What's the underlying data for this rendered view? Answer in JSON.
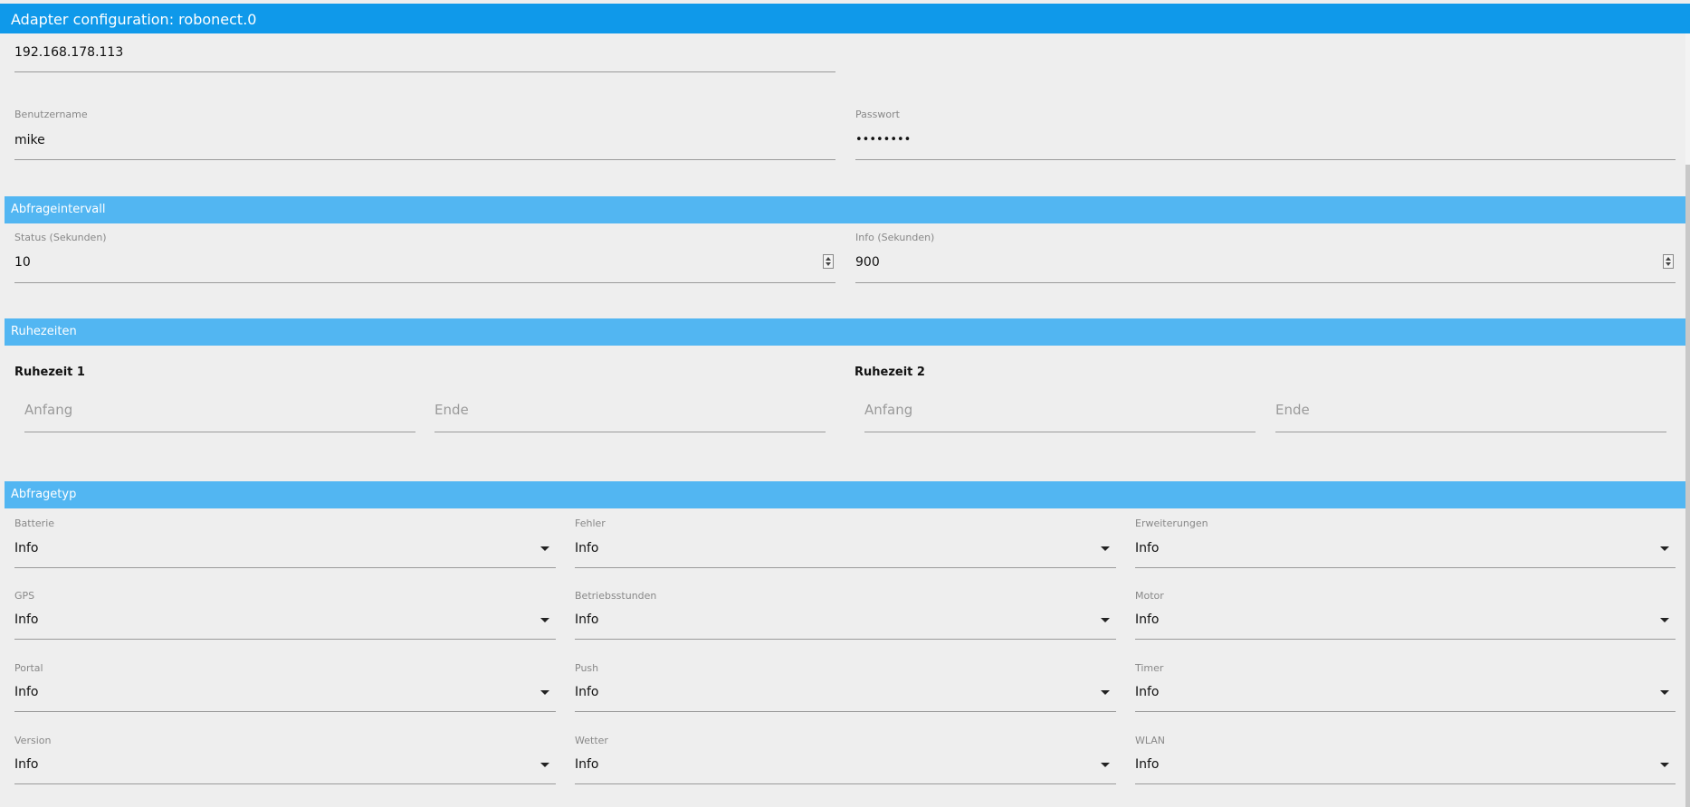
{
  "window": {
    "title": "Adapter configuration: robonect.0"
  },
  "connection": {
    "ip_value": "192.168.178.113",
    "username_label": "Benutzername",
    "username_value": "mike",
    "password_label": "Passwort",
    "password_value": "••••••••"
  },
  "intervals": {
    "title": "Abfrageintervall",
    "status_label": "Status (Sekunden)",
    "status_value": "10",
    "info_label": "Info (Sekunden)",
    "info_value": "900"
  },
  "rest_times": {
    "title": "Ruhezeiten",
    "rest1_title": "Ruhezeit 1",
    "rest2_title": "Ruhezeit 2",
    "start_placeholder": "Anfang",
    "end_placeholder": "Ende"
  },
  "query_type": {
    "title": "Abfragetyp",
    "fields": [
      {
        "label": "Batterie",
        "value": "Info"
      },
      {
        "label": "Fehler",
        "value": "Info"
      },
      {
        "label": "Erweiterungen",
        "value": "Info"
      },
      {
        "label": "GPS",
        "value": "Info"
      },
      {
        "label": "Betriebsstunden",
        "value": "Info"
      },
      {
        "label": "Motor",
        "value": "Info"
      },
      {
        "label": "Portal",
        "value": "Info"
      },
      {
        "label": "Push",
        "value": "Info"
      },
      {
        "label": "Timer",
        "value": "Info"
      },
      {
        "label": "Version",
        "value": "Info"
      },
      {
        "label": "Wetter",
        "value": "Info"
      },
      {
        "label": "WLAN",
        "value": "Info"
      }
    ]
  },
  "icons": {
    "spinner": "number-spinner-icon",
    "dropdown": "dropdown-caret-icon"
  },
  "colors": {
    "titlebar": "#0f99ea",
    "section_header": "#52b6f2",
    "background": "#eeeeee"
  }
}
